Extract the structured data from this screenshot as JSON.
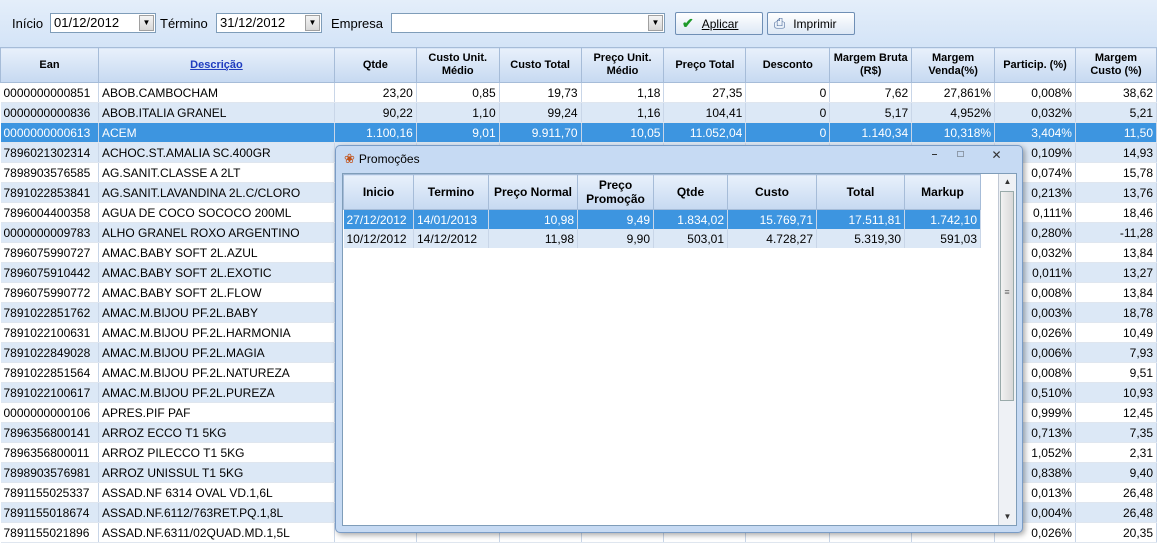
{
  "filters": {
    "inicio_label": "Início",
    "inicio_value": "01/12/2012",
    "termino_label": "Término",
    "termino_value": "31/12/2012",
    "empresa_label": "Empresa",
    "empresa_value": "",
    "aplicar_label": "Aplicar",
    "imprimir_label": "Imprimir"
  },
  "grid": {
    "headers": [
      "Ean",
      "Descrição",
      "Qtde",
      "Custo Unit. Médio",
      "Custo Total",
      "Preço Unit. Médio",
      "Preço Total",
      "Desconto",
      "Margem Bruta (R$)",
      "Margem Venda(%)",
      "Particip. (%)",
      "Margem Custo (%)"
    ],
    "rows": [
      [
        "0000000000851",
        "ABOB.CAMBOCHAM",
        "23,20",
        "0,85",
        "19,73",
        "1,18",
        "27,35",
        "0",
        "7,62",
        "27,861%",
        "0,008%",
        "38,62"
      ],
      [
        "0000000000836",
        "ABOB.ITALIA GRANEL",
        "90,22",
        "1,10",
        "99,24",
        "1,16",
        "104,41",
        "0",
        "5,17",
        "4,952%",
        "0,032%",
        "5,21"
      ],
      [
        "0000000000613",
        "ACEM",
        "1.100,16",
        "9,01",
        "9.911,70",
        "10,05",
        "11.052,04",
        "0",
        "1.140,34",
        "10,318%",
        "3,404%",
        "11,50"
      ],
      [
        "7896021302314",
        "ACHOC.ST.AMALIA SC.400GR",
        "",
        "",
        "",
        "",
        "",
        "",
        "",
        "",
        "0,109%",
        "14,93"
      ],
      [
        "7898903576585",
        "AG.SANIT.CLASSE A 2LT",
        "",
        "",
        "",
        "",
        "",
        "",
        "",
        "",
        "0,074%",
        "15,78"
      ],
      [
        "7891022853841",
        "AG.SANIT.LAVANDINA 2L.C/CLORO",
        "",
        "",
        "",
        "",
        "",
        "",
        "",
        "",
        "0,213%",
        "13,76"
      ],
      [
        "7896004400358",
        "AGUA DE COCO SOCOCO 200ML",
        "",
        "",
        "",
        "",
        "",
        "",
        "",
        "",
        "0,111%",
        "18,46"
      ],
      [
        "0000000009783",
        "ALHO GRANEL ROXO ARGENTINO",
        "",
        "",
        "",
        "",
        "",
        "",
        "",
        "",
        "0,280%",
        "-11,28"
      ],
      [
        "7896075990727",
        "AMAC.BABY SOFT 2L.AZUL",
        "",
        "",
        "",
        "",
        "",
        "",
        "",
        "",
        "0,032%",
        "13,84"
      ],
      [
        "7896075910442",
        "AMAC.BABY SOFT 2L.EXOTIC",
        "",
        "",
        "",
        "",
        "",
        "",
        "",
        "",
        "0,011%",
        "13,27"
      ],
      [
        "7896075990772",
        "AMAC.BABY SOFT 2L.FLOW",
        "",
        "",
        "",
        "",
        "",
        "",
        "",
        "",
        "0,008%",
        "13,84"
      ],
      [
        "7891022851762",
        "AMAC.M.BIJOU PF.2L.BABY",
        "",
        "",
        "",
        "",
        "",
        "",
        "",
        "",
        "0,003%",
        "18,78"
      ],
      [
        "7891022100631",
        "AMAC.M.BIJOU PF.2L.HARMONIA",
        "",
        "",
        "",
        "",
        "",
        "",
        "",
        "",
        "0,026%",
        "10,49"
      ],
      [
        "7891022849028",
        "AMAC.M.BIJOU PF.2L.MAGIA",
        "",
        "",
        "",
        "",
        "",
        "",
        "",
        "",
        "0,006%",
        "7,93"
      ],
      [
        "7891022851564",
        "AMAC.M.BIJOU PF.2L.NATUREZA",
        "",
        "",
        "",
        "",
        "",
        "",
        "",
        "",
        "0,008%",
        "9,51"
      ],
      [
        "7891022100617",
        "AMAC.M.BIJOU PF.2L.PUREZA",
        "",
        "",
        "",
        "",
        "",
        "",
        "",
        "",
        "0,510%",
        "10,93"
      ],
      [
        "0000000000106",
        "APRES.PIF PAF",
        "",
        "",
        "",
        "",
        "",
        "",
        "",
        "",
        "0,999%",
        "12,45"
      ],
      [
        "7896356800141",
        "ARROZ ECCO T1 5KG",
        "",
        "",
        "",
        "",
        "",
        "",
        "",
        "",
        "0,713%",
        "7,35"
      ],
      [
        "7896356800011",
        "ARROZ PILECCO T1 5KG",
        "",
        "",
        "",
        "",
        "",
        "",
        "",
        "",
        "1,052%",
        "2,31"
      ],
      [
        "7898903576981",
        "ARROZ UNISSUL T1 5KG",
        "",
        "",
        "",
        "",
        "",
        "",
        "",
        "",
        "0,838%",
        "9,40"
      ],
      [
        "7891155025337",
        "ASSAD.NF 6314 OVAL VD.1,6L",
        "",
        "",
        "",
        "",
        "",
        "",
        "",
        "",
        "0,013%",
        "26,48"
      ],
      [
        "7891155018674",
        "ASSAD.NF.6112/763RET.PQ.1,8L",
        "",
        "",
        "",
        "",
        "",
        "",
        "",
        "",
        "0,004%",
        "26,48"
      ],
      [
        "7891155021896",
        "ASSAD.NF.6311/02QUAD.MD.1,5L",
        "",
        "",
        "",
        "",
        "",
        "",
        "",
        "",
        "0,026%",
        "20,35"
      ]
    ]
  },
  "dialog": {
    "title": "Promoções",
    "headers": [
      "Inicio",
      "Termino",
      "Preço Normal",
      "Preço Promoção",
      "Qtde",
      "Custo",
      "Total",
      "Markup"
    ],
    "rows": [
      [
        "27/12/2012",
        "14/01/2013",
        "10,98",
        "9,49",
        "1.834,02",
        "15.769,71",
        "17.511,81",
        "1.742,10"
      ],
      [
        "10/12/2012",
        "14/12/2012",
        "11,98",
        "9,90",
        "503,01",
        "4.728,27",
        "5.319,30",
        "591,03"
      ]
    ]
  }
}
